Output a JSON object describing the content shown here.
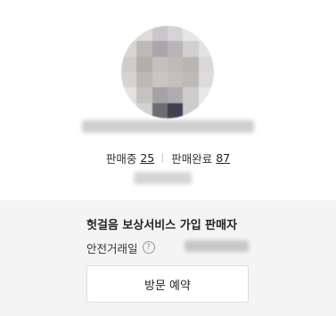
{
  "seller": {
    "stats": {
      "selling_label": "판매중",
      "selling_count": "25",
      "sold_label": "판매완료",
      "sold_count": "87"
    }
  },
  "trust": {
    "title": "헛걸음 보상서비스 가입 판매자",
    "safe_trade_label": "안전거래일",
    "help_glyph": "?",
    "help_icon": "question-circle-icon"
  },
  "actions": {
    "visit_label": "방문 예약"
  },
  "colors": {
    "panel_background": "#f4f4f4",
    "button_border": "#dddddd",
    "text_primary": "#222222"
  }
}
